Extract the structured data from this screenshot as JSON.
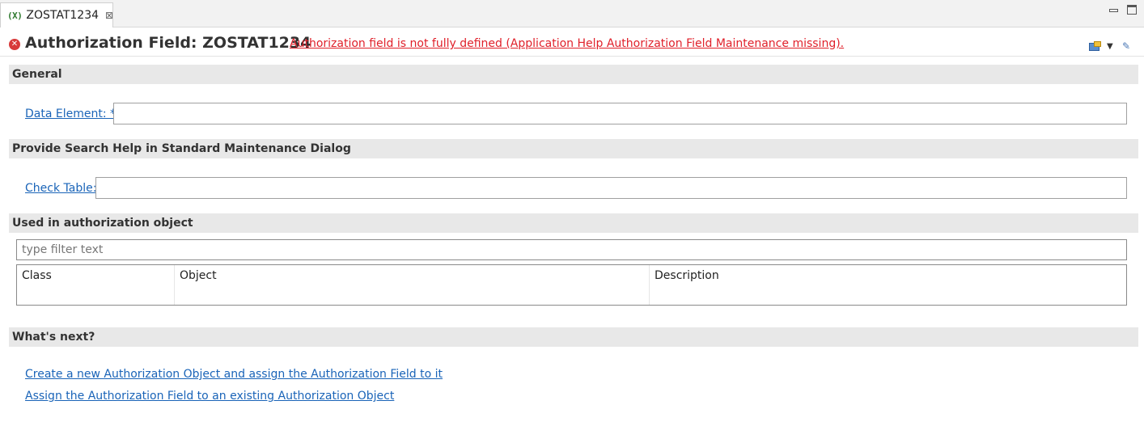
{
  "tab": {
    "icon_text": "(X)",
    "title": "ZOSTAT1234",
    "close_glyph": "⊠"
  },
  "header": {
    "title": "Authorization Field: ZOSTAT1234",
    "error_message": "Authorization field  is not fully defined (Application Help Authorization Field Maintenance missing).",
    "error_icon": "x-circle-icon",
    "dropdown_glyph": "▼",
    "edit_glyph": "✎"
  },
  "sections": {
    "general": {
      "title": "General",
      "data_element_label": "Data Element: *",
      "data_element_value": ""
    },
    "search_help": {
      "title": "Provide Search Help in Standard Maintenance Dialog",
      "check_table_label": "Check Table:",
      "check_table_value": ""
    },
    "used_in": {
      "title": "Used in authorization object",
      "filter_placeholder": "type filter text",
      "columns": [
        "Class",
        "Object",
        "Description"
      ],
      "rows": []
    },
    "whats_next": {
      "title": "What's next?",
      "links": [
        "Create a new Authorization Object and assign the Authorization Field to it",
        "Assign the Authorization Field to an existing Authorization Object"
      ]
    }
  },
  "colors": {
    "error": "#e0202a",
    "link": "#1a64b8",
    "section_bg": "#e8e8e8"
  }
}
